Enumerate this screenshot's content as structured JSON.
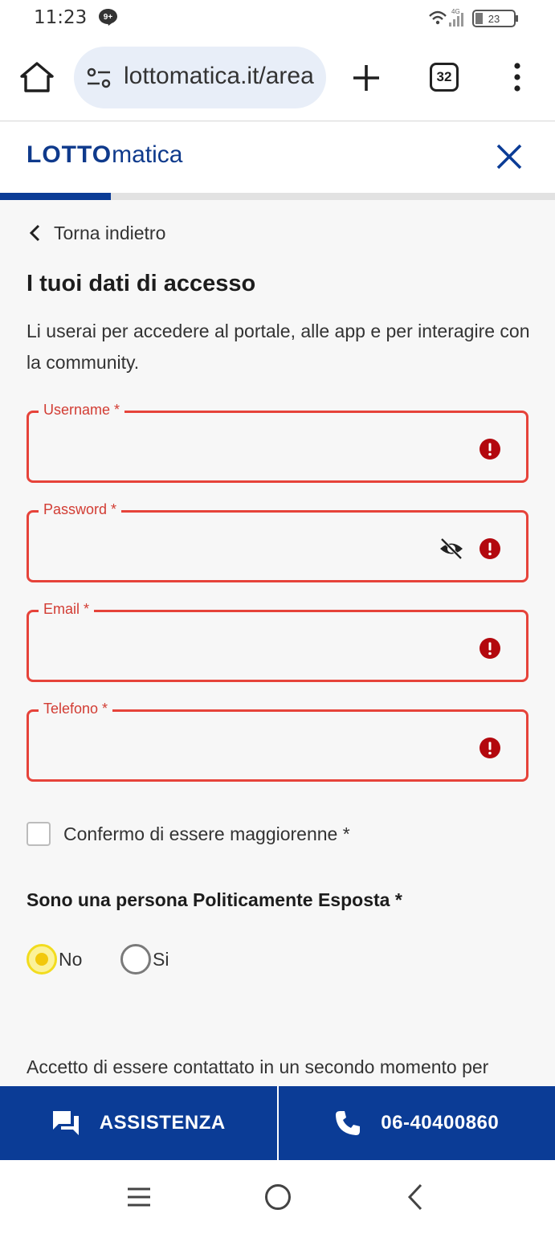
{
  "status_bar": {
    "time": "11:23",
    "notif_badge": "9+",
    "network": "4G",
    "battery": "23"
  },
  "browser": {
    "url": "lottomatica.it/area",
    "tab_count": "32"
  },
  "site": {
    "logo_prefix": "LOTTO",
    "logo_suffix": "matica",
    "progress_percent": 20
  },
  "page": {
    "back_label": "Torna indietro",
    "title": "I tuoi dati di accesso",
    "description": "Li userai per accedere al portale, alle app e per interagire con la community."
  },
  "fields": {
    "username_label": "Username *",
    "password_label": "Password *",
    "email_label": "Email *",
    "phone_label": "Telefono *",
    "username_value": "",
    "password_value": "",
    "email_value": "",
    "phone_value": ""
  },
  "checkbox": {
    "label": "Confermo di essere maggiorenne *",
    "checked": false
  },
  "pep": {
    "question": "Sono una persona Politicamente Esposta *",
    "option_no": "No",
    "option_si": "Si",
    "selected": "No"
  },
  "consent_text": "Accetto di essere contattato in un secondo momento per",
  "actions": {
    "assist_label": "ASSISTENZA",
    "phone_label": "06-40400860"
  },
  "colors": {
    "brand_blue": "#0b3c96",
    "error_red": "#e6433a",
    "radio_yellow": "#f2c80c"
  }
}
